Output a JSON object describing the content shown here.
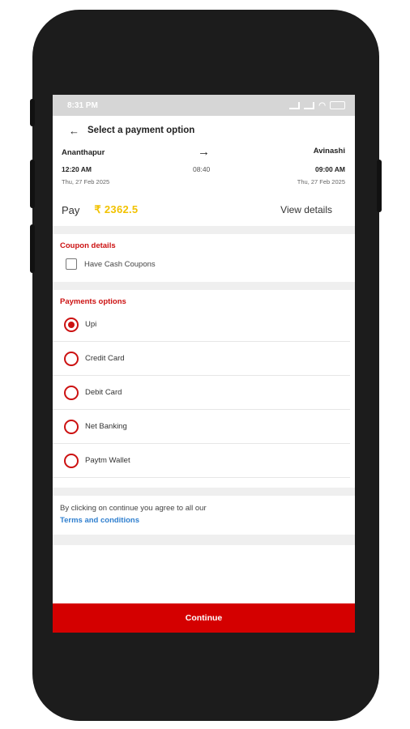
{
  "status": {
    "time": "8:31 PM"
  },
  "header": {
    "back_icon": "arrow-left-icon",
    "title": "Select a payment option"
  },
  "route": {
    "from_city": "Ananthapur",
    "to_city": "Avinashi",
    "depart_time": "12:20 AM",
    "arrive_time": "09:00 AM",
    "duration": "08:40",
    "depart_date": "Thu, 27 Feb 2025",
    "arrive_date": "Thu, 27 Feb 2025",
    "arrow_icon": "arrow-right-icon"
  },
  "pay": {
    "label": "Pay",
    "amount": "₹ 2362.5",
    "view_details": "View details"
  },
  "coupon": {
    "title": "Coupon details",
    "checkbox_label": "Have Cash Coupons",
    "checked": false
  },
  "payments": {
    "title": "Payments options",
    "options": [
      {
        "label": "Upi",
        "selected": true
      },
      {
        "label": "Credit Card",
        "selected": false
      },
      {
        "label": "Debit Card",
        "selected": false
      },
      {
        "label": "Net Banking",
        "selected": false
      },
      {
        "label": "Paytm Wallet",
        "selected": false
      }
    ]
  },
  "terms": {
    "text": "By clicking on continue you agree to all our",
    "link": "Terms and conditions"
  },
  "continue_label": "Continue",
  "colors": {
    "accent": "#cc1111",
    "amount": "#f2c200",
    "link": "#2f7fcf",
    "button": "#d40000"
  }
}
